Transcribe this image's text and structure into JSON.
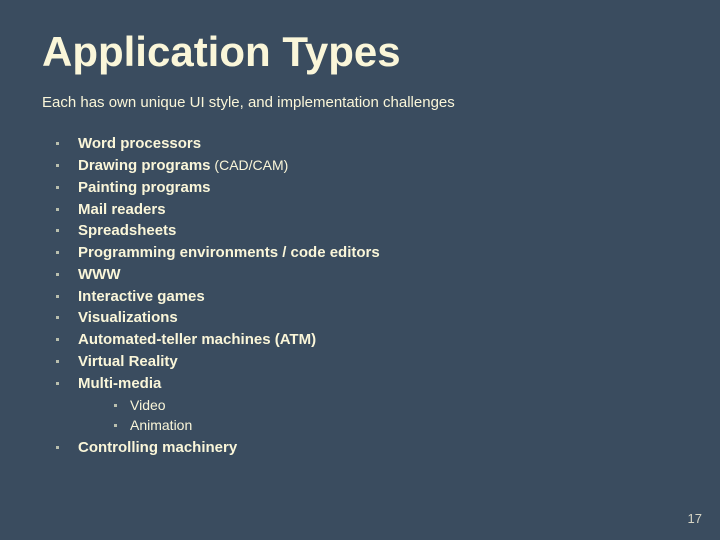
{
  "title": "Application Types",
  "subtitle": "Each has own unique UI style, and implementation challenges",
  "items": [
    {
      "text": "Word processors"
    },
    {
      "text": "Drawing programs",
      "annot": " (CAD/CAM)"
    },
    {
      "text": "Painting programs"
    },
    {
      "text": "Mail readers"
    },
    {
      "text": "Spreadsheets"
    },
    {
      "text": "Programming environments / code editors"
    },
    {
      "text": "WWW"
    },
    {
      "text": "Interactive games"
    },
    {
      "text": "Visualizations"
    },
    {
      "text": "Automated-teller machines (ATM)"
    },
    {
      "text": "Virtual Reality"
    },
    {
      "text": "Multi-media",
      "sub": [
        "Video",
        "Animation"
      ]
    },
    {
      "text": "Controlling machinery"
    }
  ],
  "page_number": "17"
}
